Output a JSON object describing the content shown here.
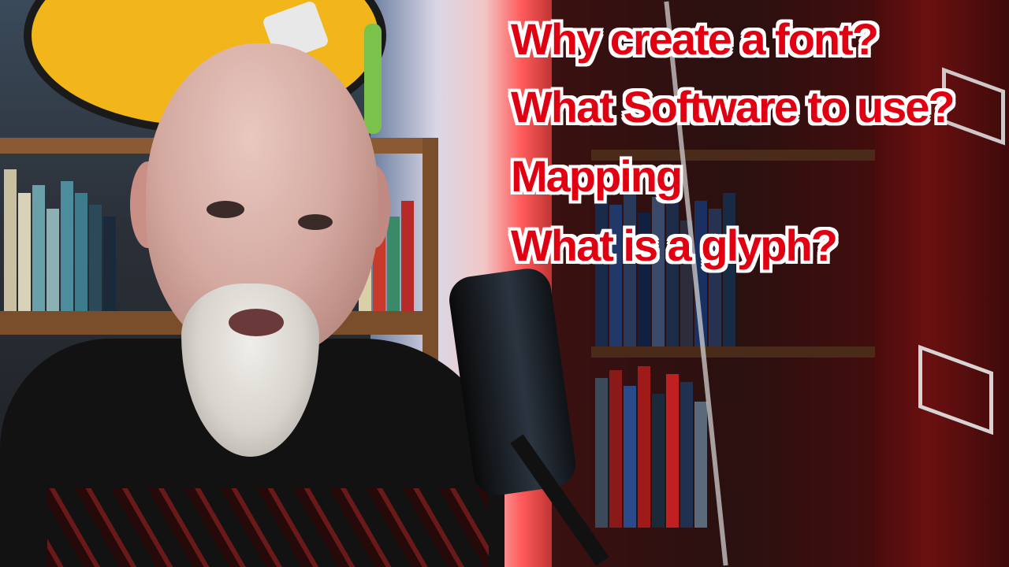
{
  "overlay": {
    "lines": [
      "Why create a font?",
      "What Software to use?",
      "Mapping",
      "What is a glyph?"
    ],
    "text_color": "#e00012",
    "outline_color": "#ffffff"
  },
  "scene": {
    "shield_color": "#f2b51a",
    "cabinet_color": "#6a1010"
  }
}
